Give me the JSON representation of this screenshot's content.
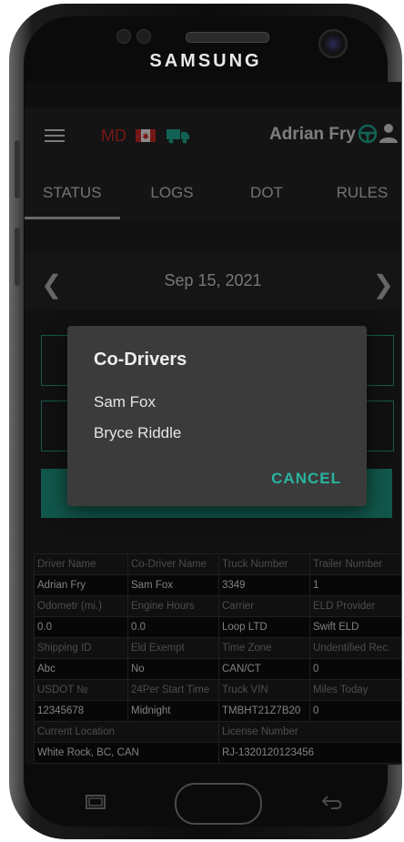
{
  "device": {
    "brand": "SAMSUNG"
  },
  "appbar": {
    "state": "MD",
    "user_name": "Adrian Fry"
  },
  "tabs": [
    "STATUS",
    "LOGS",
    "DOT",
    "RULES"
  ],
  "date_nav": {
    "date": "Sep 15, 2021"
  },
  "dialog": {
    "title": "Co-Drivers",
    "items": [
      "Sam Fox",
      "Bryce Riddle"
    ],
    "cancel_label": "CANCEL"
  },
  "info_table": {
    "rows": [
      {
        "type": "hdr",
        "cells": [
          "Driver Name",
          "Co-Driver Name",
          "Truck Number",
          "Trailer Number"
        ]
      },
      {
        "type": "val",
        "cells": [
          "Adrian Fry",
          "Sam Fox",
          "3349",
          "1"
        ]
      },
      {
        "type": "hdr",
        "cells": [
          "Odometr (mi.)",
          "Engine Hours",
          "Carrier",
          "ELD Provider"
        ]
      },
      {
        "type": "val",
        "cells": [
          "0.0",
          "0.0",
          "Loop LTD",
          "Swift ELD"
        ]
      },
      {
        "type": "hdr",
        "cells": [
          "Shipping ID",
          "Eld Exempt",
          "Time Zone",
          "Undentified Rec."
        ]
      },
      {
        "type": "val",
        "cells": [
          "Abc",
          "No",
          "CAN/CT",
          "0"
        ]
      },
      {
        "type": "hdr",
        "cells": [
          "USDOT №",
          "24Per Start Time",
          "Truck VIN",
          "Miles Today"
        ]
      },
      {
        "type": "val",
        "cells": [
          "12345678",
          "Midnight",
          "TMBHT21Z7B20",
          "0"
        ]
      },
      {
        "type": "hdr2",
        "cells": [
          "Current Location",
          "License Number"
        ]
      },
      {
        "type": "val2",
        "cells": [
          "White Rock, BC, CAN",
          "RJ-1320120123456"
        ]
      }
    ]
  },
  "colors": {
    "accent": "#1f9d88",
    "state_red": "#d82a2a",
    "background": "#202020"
  }
}
